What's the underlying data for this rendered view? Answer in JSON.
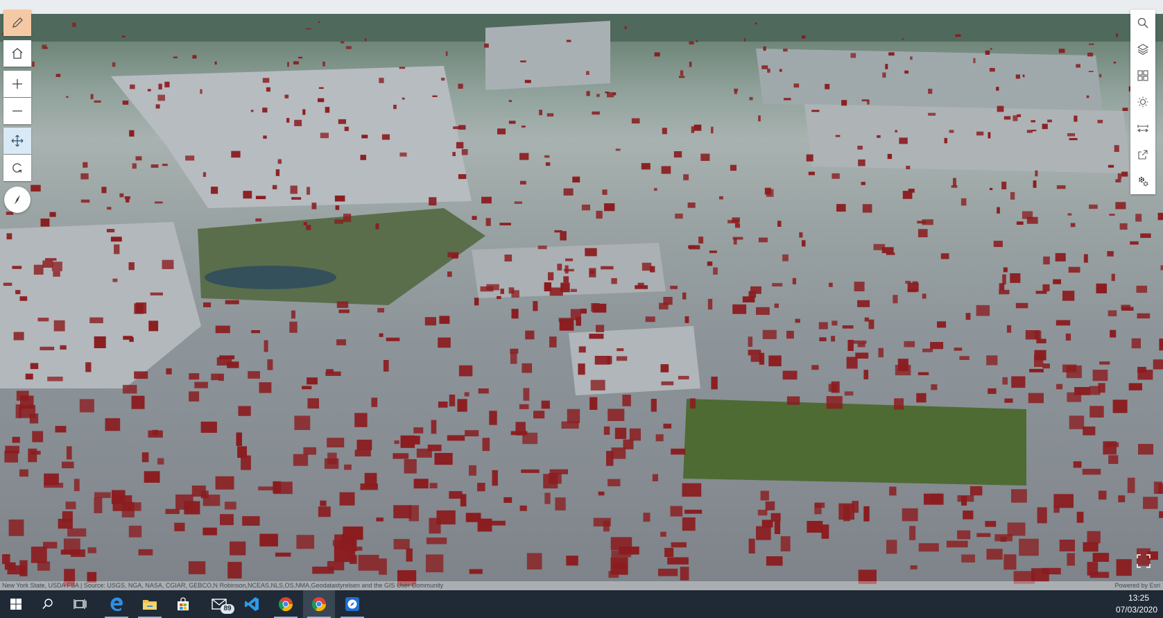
{
  "left_toolbar": {
    "items": [
      {
        "name": "sketch-tool",
        "icon": "pencil-icon",
        "state": "active"
      },
      {
        "name": "home",
        "icon": "home-icon"
      },
      {
        "name": "zoom-in",
        "icon": "plus-icon"
      },
      {
        "name": "zoom-out",
        "icon": "minus-icon"
      },
      {
        "name": "pan",
        "icon": "move-icon",
        "state": "active"
      },
      {
        "name": "rotate",
        "icon": "rotate-icon"
      },
      {
        "name": "compass",
        "icon": "compass-icon"
      }
    ]
  },
  "right_toolbar": {
    "items": [
      {
        "name": "search",
        "icon": "search-icon"
      },
      {
        "name": "layers",
        "icon": "layers-icon"
      },
      {
        "name": "basemap-gallery",
        "icon": "grid-icon"
      },
      {
        "name": "daylight",
        "icon": "sun-icon"
      },
      {
        "name": "measure",
        "icon": "measure-icon"
      },
      {
        "name": "share",
        "icon": "share-icon"
      },
      {
        "name": "settings",
        "icon": "gears-icon"
      }
    ]
  },
  "attribution": {
    "sources": "New York State, USDA FSA | Source: USGS, NGA, NASA, CGIAR, GEBCO,N Robinson,NCEAS,NLS,OS,NMA,Geodatastyrelsen and the GIS User Community",
    "powered_by": "Powered by Esri"
  },
  "scene": {
    "building_color": "#8b1c1f",
    "park_color": "#4e6b33"
  },
  "taskbar": {
    "apps": [
      {
        "name": "start",
        "icon": "windows-icon"
      },
      {
        "name": "search",
        "icon": "search-icon"
      },
      {
        "name": "task-view",
        "icon": "task-view-icon"
      },
      {
        "name": "edge",
        "icon": "edge-icon"
      },
      {
        "name": "file-explorer",
        "icon": "folder-icon"
      },
      {
        "name": "store",
        "icon": "store-icon"
      },
      {
        "name": "mail",
        "icon": "mail-icon",
        "badge": "89"
      },
      {
        "name": "vscode",
        "icon": "vscode-icon"
      },
      {
        "name": "chrome",
        "icon": "chrome-icon"
      },
      {
        "name": "chrome-active",
        "icon": "chrome-icon",
        "state": "active"
      },
      {
        "name": "arcgis",
        "icon": "compass-app-icon"
      }
    ],
    "mail_badge": "89",
    "clock": {
      "time": "13:25",
      "date": "07/03/2020"
    }
  }
}
